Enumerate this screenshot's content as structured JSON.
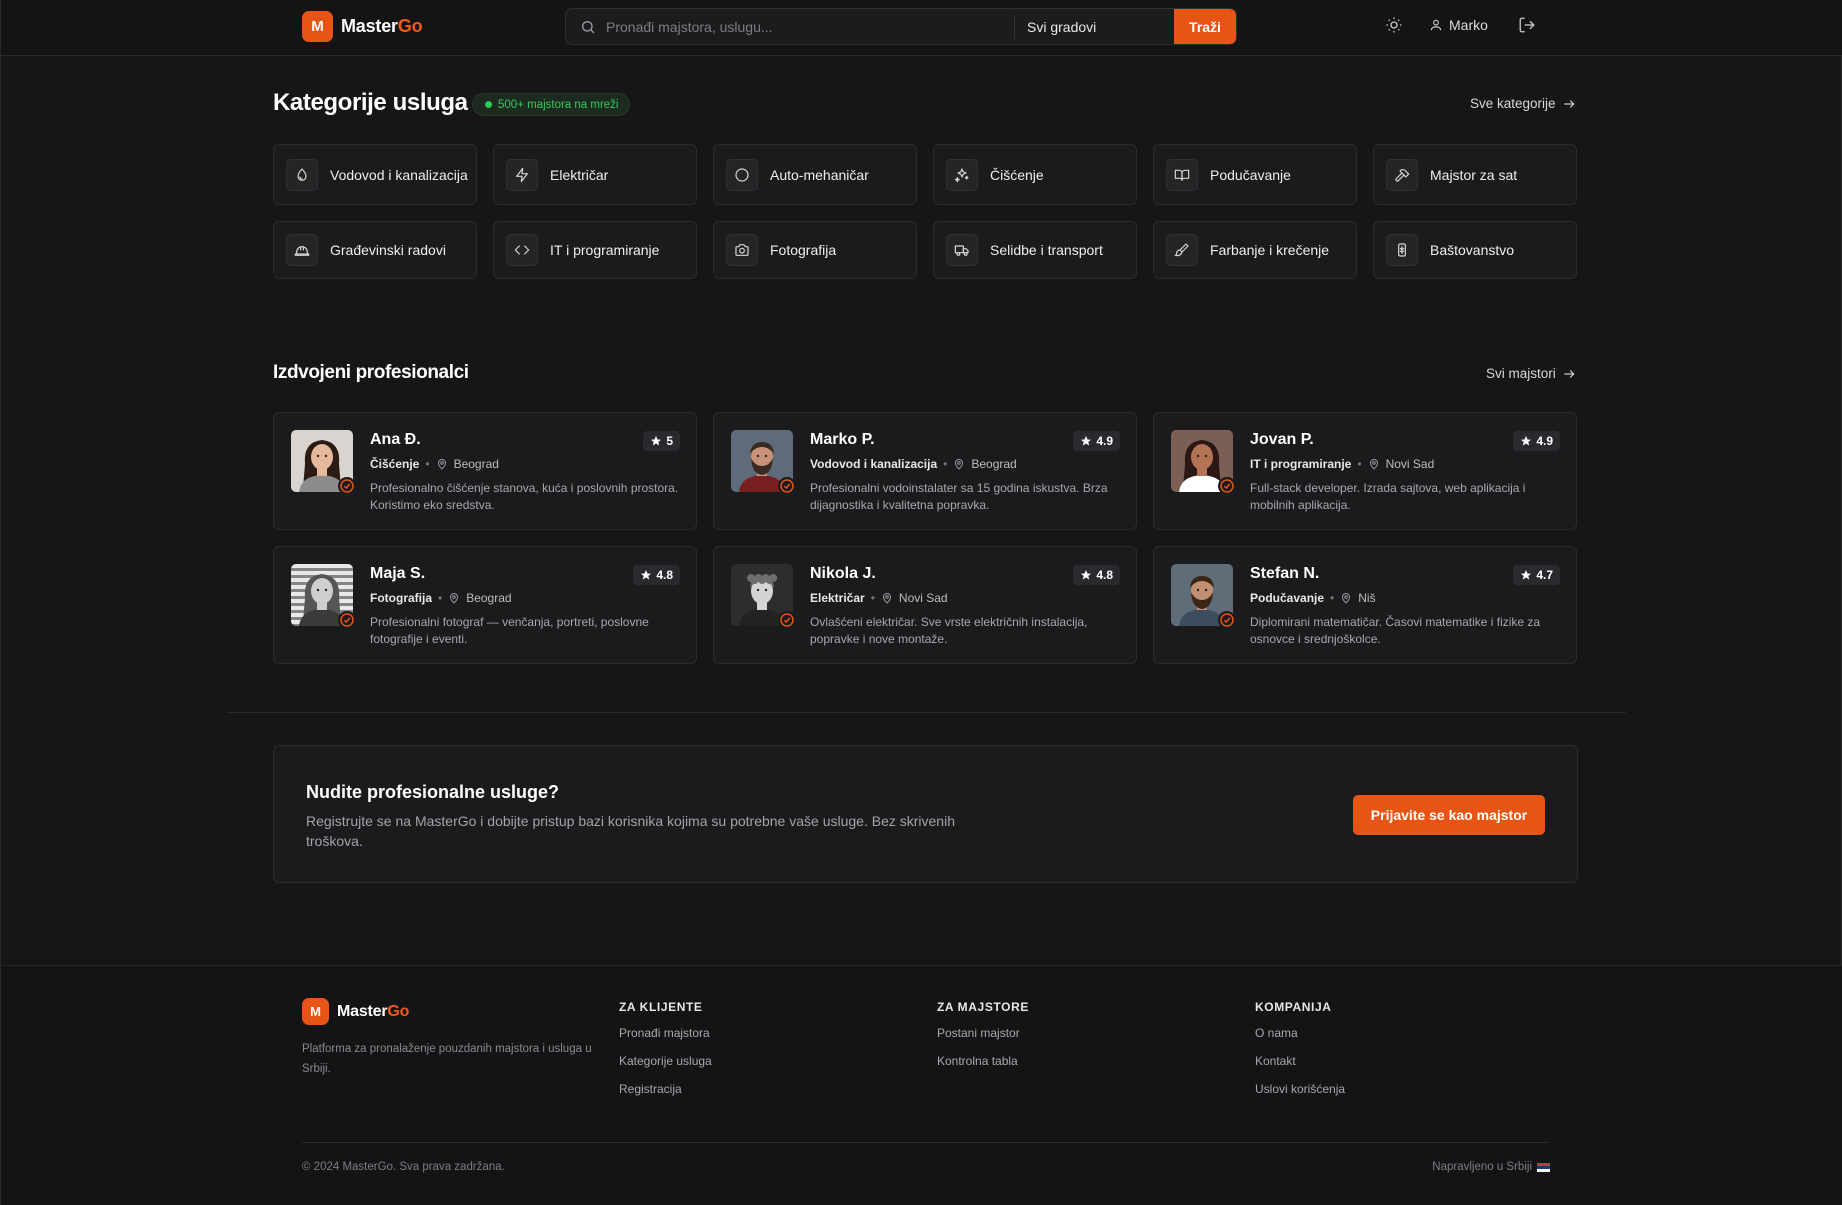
{
  "header": {
    "brand_prefix": "Master",
    "brand_accent": "Go",
    "logo_letter": "M",
    "search_placeholder": "Pronađi majstora, uslugu...",
    "city_value": "Svi gradovi",
    "search_button": "Traži",
    "user_name": "Marko"
  },
  "categories_section": {
    "title": "Kategorije usluga",
    "badge": "500+ majstora na mreži",
    "see_all": "Sve kategorije",
    "items": [
      {
        "label": "Vodovod i kanalizacija",
        "icon": "droplet-icon"
      },
      {
        "label": "Električar",
        "icon": "lightning-icon"
      },
      {
        "label": "Auto-mehaničar",
        "icon": "circle-icon"
      },
      {
        "label": "Čišćenje",
        "icon": "sparkles-icon"
      },
      {
        "label": "Podučavanje",
        "icon": "book-icon"
      },
      {
        "label": "Majstor za sat",
        "icon": "hammer-icon"
      },
      {
        "label": "Građevinski radovi",
        "icon": "hard-hat-icon"
      },
      {
        "label": "IT i programiranje",
        "icon": "code-icon"
      },
      {
        "label": "Fotografija",
        "icon": "camera-icon"
      },
      {
        "label": "Selidbe i transport",
        "icon": "truck-icon"
      },
      {
        "label": "Farbanje i krečenje",
        "icon": "paintbrush-icon"
      },
      {
        "label": "Baštovanstvo",
        "icon": "plant-icon"
      }
    ]
  },
  "pros_section": {
    "title": "Izdvojeni profesionalci",
    "see_all": "Svi majstori",
    "items": [
      {
        "name": "Ana Đ.",
        "rating": "5",
        "category": "Čišćenje",
        "city": "Beograd",
        "desc": "Profesionalno čišćenje stanova, kuća i poslovnih prostora. Koristimo eko sredstva."
      },
      {
        "name": "Marko P.",
        "rating": "4.9",
        "category": "Vodovod i kanalizacija",
        "city": "Beograd",
        "desc": "Profesionalni vodoinstalater sa 15 godina iskustva. Brza dijagnostika i kvalitetna popravka."
      },
      {
        "name": "Jovan P.",
        "rating": "4.9",
        "category": "IT i programiranje",
        "city": "Novi Sad",
        "desc": "Full-stack developer. Izrada sajtova, web aplikacija i mobilnih aplikacija."
      },
      {
        "name": "Maja S.",
        "rating": "4.8",
        "category": "Fotografija",
        "city": "Beograd",
        "desc": "Profesionalni fotograf — venčanja, portreti, poslovne fotografije i eventi."
      },
      {
        "name": "Nikola J.",
        "rating": "4.8",
        "category": "Električar",
        "city": "Novi Sad",
        "desc": "Ovlašćeni električar. Sve vrste električnih instalacija, popravke i nove montaže."
      },
      {
        "name": "Stefan N.",
        "rating": "4.7",
        "category": "Podučavanje",
        "city": "Niš",
        "desc": "Diplomirani matematičar. Časovi matematike i fizike za osnovce i srednjoškolce."
      }
    ]
  },
  "cta": {
    "title": "Nudite profesionalne usluge?",
    "text": "Registrujte se na MasterGo i dobijte pristup bazi korisnika kojima su potrebne vaše usluge. Bez skrivenih troškova.",
    "button": "Prijavite se kao majstor"
  },
  "footer": {
    "about": "Platforma za pronalaženje pouzdanih majstora i usluga u Srbiji.",
    "columns": [
      {
        "title": "ZA KLIJENTE",
        "links": [
          "Pronađi majstora",
          "Kategorije usluga",
          "Registracija"
        ]
      },
      {
        "title": "ZA MAJSTORE",
        "links": [
          "Postani majstor",
          "Kontrolna tabla"
        ]
      },
      {
        "title": "KOMPANIJA",
        "links": [
          "O nama",
          "Kontakt",
          "Uslovi korišćenja"
        ]
      }
    ],
    "copyright": "© 2024 MasterGo. Sva prava zadržana.",
    "made_in": "Napravljeno u Srbiji"
  },
  "colors": {
    "accent": "#e85416",
    "background": "#161618",
    "card": "#1b1b1e",
    "online": "#2fcb5b"
  }
}
